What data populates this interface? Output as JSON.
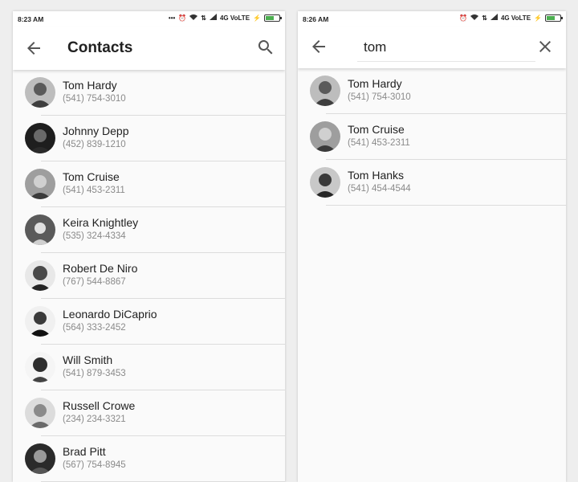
{
  "left": {
    "status": {
      "time": "8:23 AM",
      "network": "4G VoLTE"
    },
    "title": "Contacts",
    "contacts": [
      {
        "name": "Tom Hardy",
        "phone": "(541) 754-3010"
      },
      {
        "name": "Johnny Depp",
        "phone": "(452) 839-1210"
      },
      {
        "name": "Tom Cruise",
        "phone": "(541) 453-2311"
      },
      {
        "name": "Keira Knightley",
        "phone": "(535) 324-4334"
      },
      {
        "name": "Robert De Niro",
        "phone": "(767) 544-8867"
      },
      {
        "name": "Leonardo DiCaprio",
        "phone": "(564) 333-2452"
      },
      {
        "name": "Will Smith",
        "phone": "(541) 879-3453"
      },
      {
        "name": "Russell Crowe",
        "phone": "(234) 234-3321"
      },
      {
        "name": "Brad Pitt",
        "phone": "(567) 754-8945"
      }
    ]
  },
  "right": {
    "status": {
      "time": "8:26 AM",
      "network": "4G VoLTE"
    },
    "search": {
      "query": "tom"
    },
    "results": [
      {
        "name": "Tom Hardy",
        "phone": "(541) 754-3010"
      },
      {
        "name": "Tom Cruise",
        "phone": "(541) 453-2311"
      },
      {
        "name": "Tom Hanks",
        "phone": "(541) 454-4544"
      }
    ]
  },
  "icons": {
    "back": "arrow-left-icon",
    "search": "search-icon",
    "clear": "close-icon",
    "avatar": "avatar-photo"
  },
  "colors": {
    "appbar": "#ffffff",
    "list_bg": "#fafafa",
    "name_text": "#212121",
    "phone_text": "#8a8a8a",
    "divider": "#dcdcdc",
    "battery": "#4caf50"
  }
}
